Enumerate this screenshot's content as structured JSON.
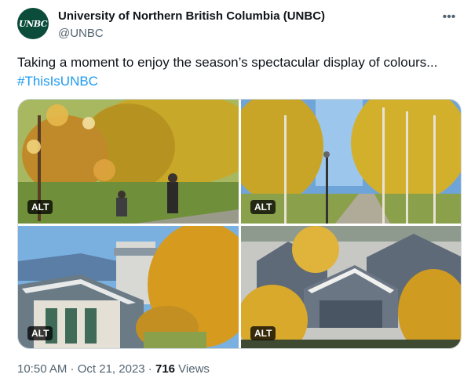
{
  "author": {
    "avatar_text": "UNBC",
    "display_name": "University of Northern British Columbia (UNBC)",
    "handle": "@UNBC"
  },
  "more_icon": "more-horizontal-icon",
  "tweet": {
    "text": "Taking a moment to enjoy the season’s spectacular display of colours...",
    "hashtag": "#ThisIsUNBC"
  },
  "media": {
    "alt_badges": [
      "ALT",
      "ALT",
      "ALT",
      "ALT"
    ]
  },
  "meta": {
    "time": "10:50 AM",
    "separator": " · ",
    "date": "Oct 21, 2023",
    "views_count": "716",
    "views_label": " Views"
  },
  "colors": {
    "hashtag": "#1d9bf0",
    "avatar_bg": "#0b4d3a",
    "muted": "#536471"
  }
}
